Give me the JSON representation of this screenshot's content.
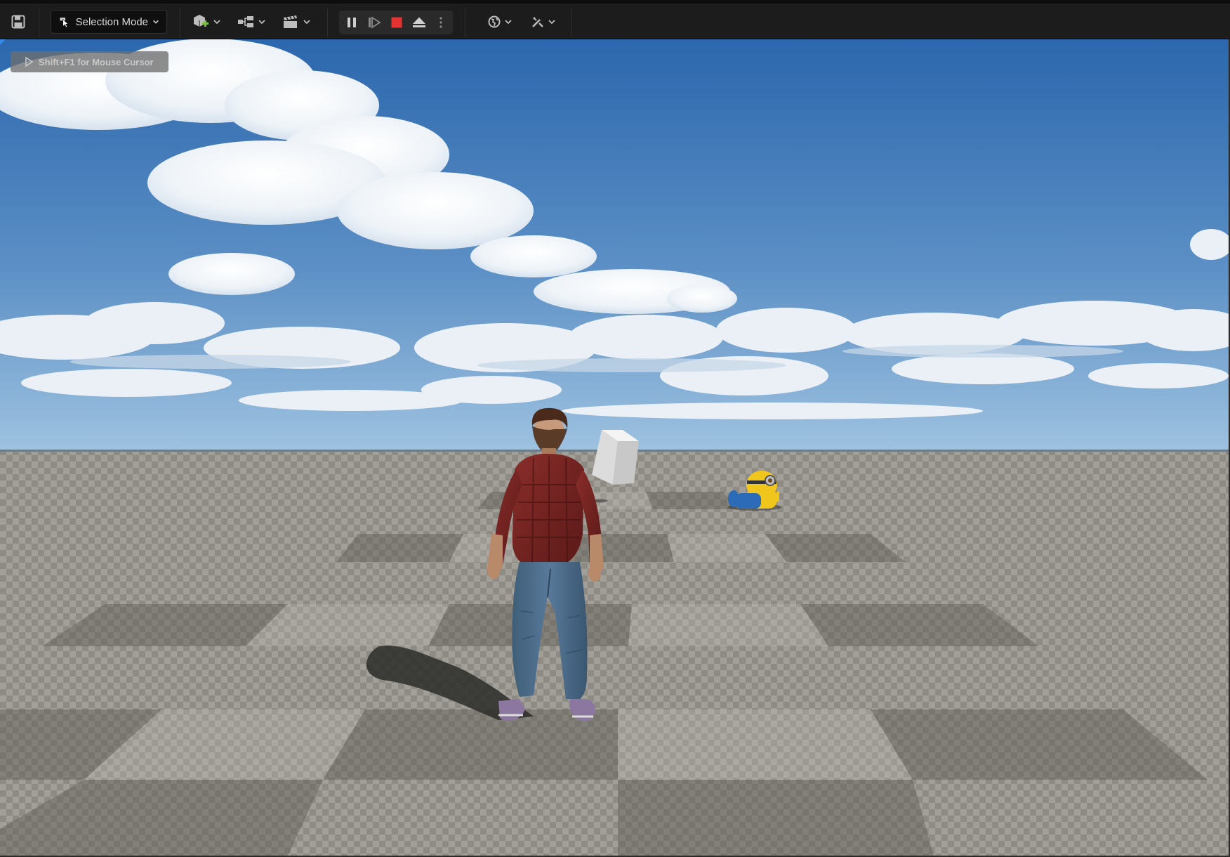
{
  "toolbar": {
    "mode_label": "Selection Mode",
    "icons": {
      "save": "save-icon",
      "mode": "cursor-select-icon",
      "add": "add-actor-icon",
      "blueprint": "blueprint-icon",
      "cinematics": "clapperboard-icon",
      "pause": "pause-icon",
      "step": "frame-skip-icon",
      "stop": "stop-icon",
      "eject": "eject-icon",
      "more": "more-options-icon",
      "platforms": "globe-icon",
      "settings": "tools-icon"
    },
    "colors": {
      "stop": "#e53232",
      "add_accent": "#7bc043"
    }
  },
  "viewport": {
    "hint_text": "Shift+F1 for Mouse Cursor",
    "colors": {
      "sky_top": "#2c67ad",
      "sky_horizon": "#9ec2e0",
      "floor_light": "#9c9890",
      "floor_dark": "#5e5b55"
    }
  }
}
